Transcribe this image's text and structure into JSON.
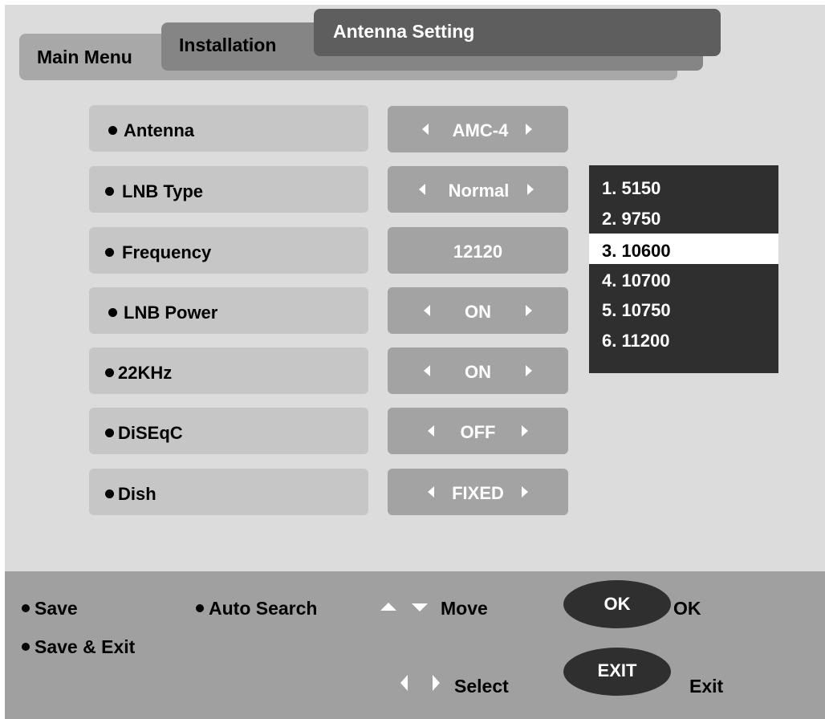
{
  "tabs": {
    "main_menu": "Main Menu",
    "installation": "Installation",
    "antenna_setting": "Antenna Setting"
  },
  "settings": [
    {
      "label": "Antenna",
      "value": "AMC-4",
      "arrows": true
    },
    {
      "label": "LNB Type",
      "value": "Normal",
      "arrows": true
    },
    {
      "label": "Frequency",
      "value": "12120",
      "arrows": false
    },
    {
      "label": "LNB Power",
      "value": "ON",
      "arrows": true
    },
    {
      "label": "22KHz",
      "value": "ON",
      "arrows": true
    },
    {
      "label": "DiSEqC",
      "value": "OFF",
      "arrows": true
    },
    {
      "label": "Dish",
      "value": "FIXED",
      "arrows": true
    }
  ],
  "lnb_dropdown": {
    "items": [
      "1. 5150",
      "2. 9750",
      "3. 10600",
      "4. 10700",
      "5. 10750",
      "6. 11200"
    ],
    "selected_index": 2
  },
  "footer": {
    "save": "Save",
    "auto_search": "Auto Search",
    "move": "Move",
    "ok_key": "OK",
    "ok_label": "OK",
    "save_exit": "Save & Exit",
    "select": "Select",
    "exit_key": "EXIT",
    "exit_label": "Exit"
  },
  "colors": {
    "background": "#dcdcdc",
    "label_box": "#c6c6c6",
    "value_box": "#a3a3a3",
    "dropdown": "#2f2f2f",
    "dropdown_selected": "#ffffff",
    "footer": "#a0a0a0"
  },
  "icons": [
    "bullet-dot-icon",
    "arrow-left-icon",
    "arrow-right-icon",
    "arrow-up-icon",
    "arrow-down-icon"
  ]
}
